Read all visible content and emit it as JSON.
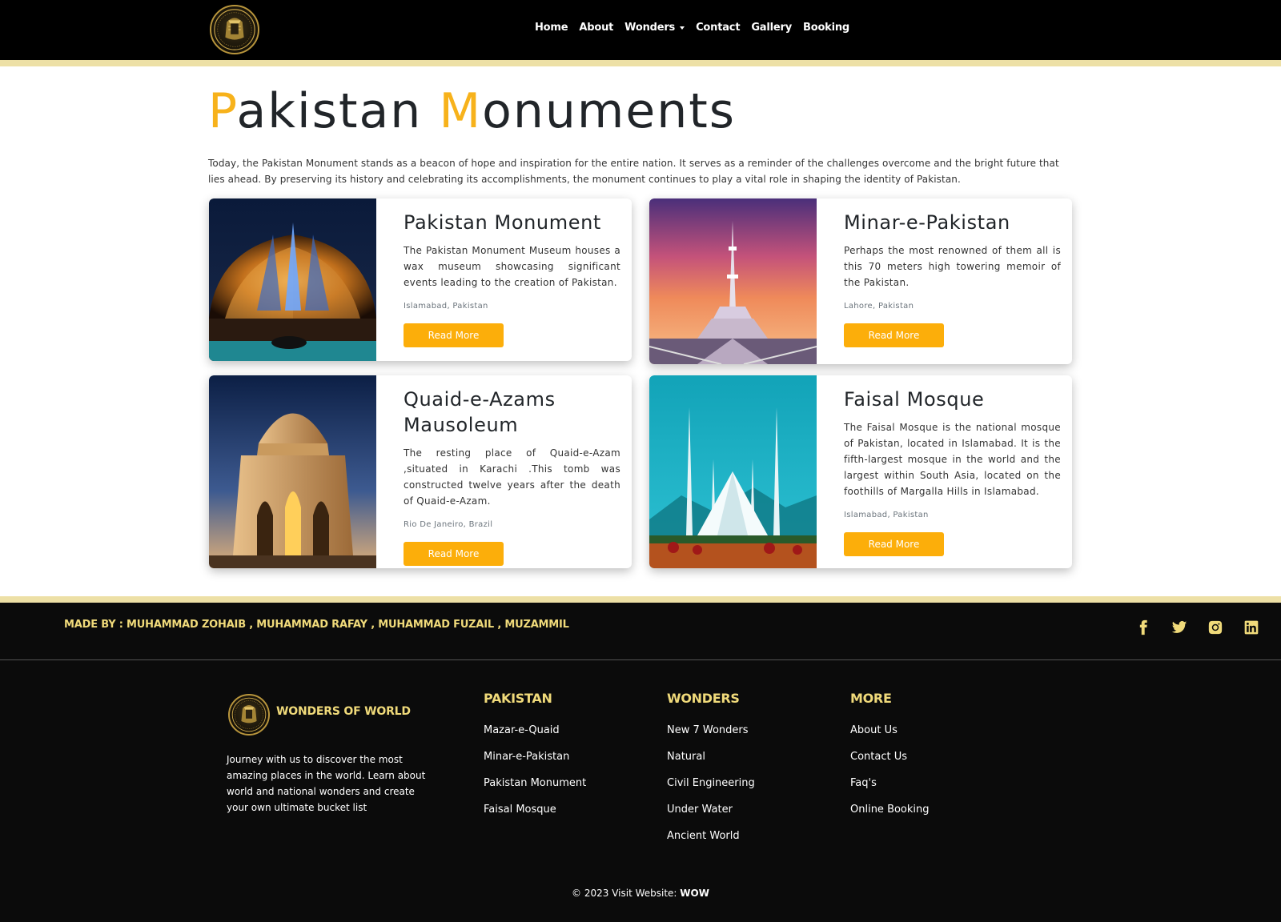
{
  "nav": {
    "links": [
      "Home",
      "About",
      "Wonders",
      "Contact",
      "Gallery",
      "Booking"
    ]
  },
  "main": {
    "title_first_letter_1": "P",
    "title_rest_1": "akistan ",
    "title_first_letter_2": "M",
    "title_rest_2": "onuments",
    "intro": "Today, the Pakistan Monument stands as a beacon of hope and inspiration for the entire nation. It serves as a reminder of the challenges overcome and the bright future that lies ahead. By preserving its history and celebrating its accomplishments, the monument continues to play a vital role in shaping the identity of Pakistan.",
    "cards": [
      {
        "title": "Pakistan Monument",
        "text": "The Pakistan Monument Museum houses a wax museum showcasing significant events leading to the creation of Pakistan.",
        "location": "Islamabad, Pakistan",
        "button": "Read More"
      },
      {
        "title": "Minar-e-Pakistan",
        "text": "Perhaps the most renowned of them all is this 70 meters high towering memoir of the Pakistan.",
        "location": "Lahore, Pakistan",
        "button": "Read More"
      },
      {
        "title": "Quaid-e-Azams Mausoleum",
        "text": "The resting place of Quaid-e-Azam ,situated in Karachi .This tomb was constructed twelve years after the death of Quaid-e-Azam.",
        "location": "Rio De Janeiro, Brazil",
        "button": "Read More"
      },
      {
        "title": "Faisal Mosque",
        "text": "The Faisal Mosque is the national mosque of Pakistan, located in Islamabad. It is the fifth-largest mosque in the world and the largest within South Asia, located on the foothills of Margalla Hills in Islamabad.",
        "location": "Islamabad, Pakistan",
        "button": "Read More"
      }
    ]
  },
  "footer": {
    "made_by": "MADE BY : MUHAMMAD ZOHAIB , MUHAMMAD RAFAY , MUHAMMAD FUZAIL , MUZAMMIL",
    "socials": [
      "facebook-icon",
      "twitter-icon",
      "instagram-icon",
      "linkedin-icon"
    ],
    "brand_name": "WONDERS OF WORLD",
    "brand_desc": "Journey with us to discover the most amazing places in the world. Learn about world and national wonders and create your own ultimate bucket list",
    "columns": [
      {
        "heading": "PAKISTAN",
        "links": [
          "Mazar-e-Quaid",
          "Minar-e-Pakistan",
          "Pakistan Monument",
          "Faisal Mosque"
        ]
      },
      {
        "heading": "WONDERS",
        "links": [
          "New 7 Wonders",
          "Natural",
          "Civil Engineering",
          "Under Water",
          "Ancient World"
        ]
      },
      {
        "heading": "MORE",
        "links": [
          "About Us",
          "Contact Us",
          "Faq's",
          "Online Booking"
        ]
      }
    ],
    "copyright_prefix": "© 2023 Visit Website: ",
    "copyright_site": "WOW"
  },
  "colors": {
    "accent": "#f7b21b",
    "button": "#fcae0a",
    "gold_text": "#f0da7a",
    "gold_strip": "#ede0a6",
    "nav_bg": "#000000",
    "footer_bg": "#0b0b0b"
  }
}
